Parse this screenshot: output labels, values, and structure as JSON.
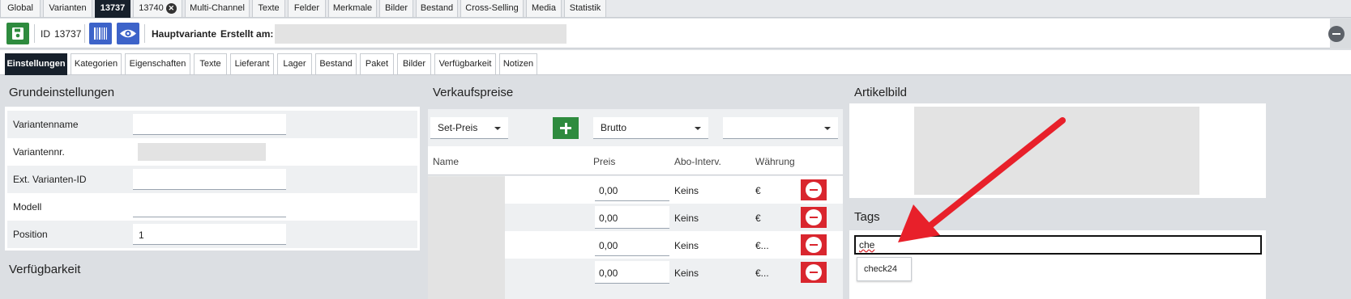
{
  "top_tabs": [
    {
      "label": "Global"
    },
    {
      "label": "Varianten"
    },
    {
      "label": "13737"
    },
    {
      "label": "13740"
    },
    {
      "label": "Multi-Channel"
    },
    {
      "label": "Texte"
    },
    {
      "label": "Felder"
    },
    {
      "label": "Merkmale"
    },
    {
      "label": "Bilder"
    },
    {
      "label": "Bestand"
    },
    {
      "label": "Cross-Selling"
    },
    {
      "label": "Media"
    },
    {
      "label": "Statistik"
    }
  ],
  "toolbar": {
    "id_label": "ID",
    "id_value": "13737",
    "variant_type": "Hauptvariante",
    "created_label": "Erstellt am:"
  },
  "sub_tabs": [
    {
      "label": "Einstellungen"
    },
    {
      "label": "Kategorien"
    },
    {
      "label": "Eigenschaften"
    },
    {
      "label": "Texte"
    },
    {
      "label": "Lieferant"
    },
    {
      "label": "Lager"
    },
    {
      "label": "Bestand"
    },
    {
      "label": "Paket"
    },
    {
      "label": "Bilder"
    },
    {
      "label": "Verfügbarkeit"
    },
    {
      "label": "Notizen"
    }
  ],
  "grundeinstellungen": {
    "title": "Grundeinstellungen",
    "fields": [
      {
        "label": "Variantenname",
        "value": ""
      },
      {
        "label": "Variantennr.",
        "value": ""
      },
      {
        "label": "Ext. Varianten-ID",
        "value": ""
      },
      {
        "label": "Modell",
        "value": ""
      },
      {
        "label": "Position",
        "value": "1"
      }
    ]
  },
  "verfuegbarkeit": {
    "title": "Verfügbarkeit"
  },
  "verkaufspreise": {
    "title": "Verkaufspreise",
    "price_type_select": "Set-Preis",
    "gross_net_select": "Brutto",
    "third_select": "",
    "columns": [
      "Name",
      "Preis",
      "Abo-Interv.",
      "Währung"
    ],
    "rows": [
      {
        "price": "0,00",
        "interval": "Keins",
        "currency": "€"
      },
      {
        "price": "0,00",
        "interval": "Keins",
        "currency": "€"
      },
      {
        "price": "0,00",
        "interval": "Keins",
        "currency": "€..."
      },
      {
        "price": "0,00",
        "interval": "Keins",
        "currency": "€..."
      }
    ]
  },
  "artikelbild": {
    "title": "Artikelbild"
  },
  "tags": {
    "title": "Tags",
    "input_value": "che",
    "suggestion": "check24"
  },
  "colors": {
    "active_tab": "#17202b",
    "save_green": "#2e8b3e",
    "accent_blue": "#3d63c9",
    "delete_red": "#d9262e",
    "annotation_arrow": "#e8202a"
  },
  "icons": {
    "save": "floppy-disk-icon",
    "barcode": "barcode-icon",
    "preview": "eye-icon",
    "close_tab": "close-icon",
    "collapse": "minus-circle-icon",
    "add": "plus-icon",
    "remove": "minus-circle-icon"
  }
}
